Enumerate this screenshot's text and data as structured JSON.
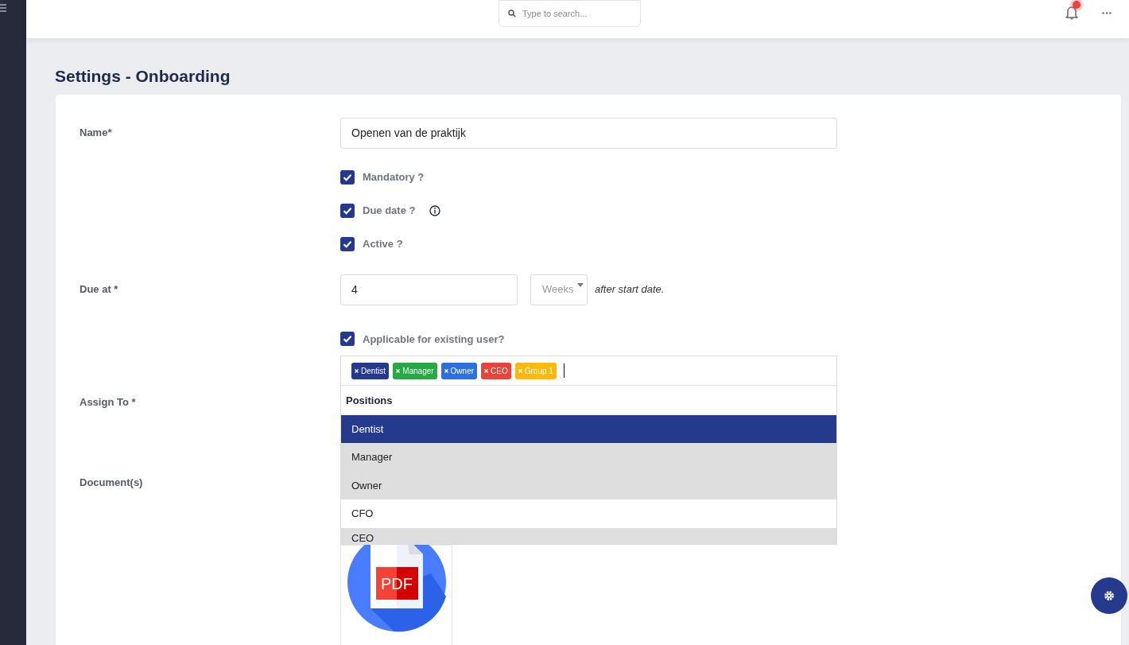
{
  "topbar": {
    "search": {
      "placeholder": "Type to search..."
    },
    "notification_dot": true
  },
  "page_title": "Settings - Onboarding",
  "form": {
    "name": {
      "label": "Name*",
      "value": "Openen van de praktijk"
    },
    "options": [
      {
        "label": "Mandatory ?",
        "checked": true,
        "info": false
      },
      {
        "label": "Due date ?",
        "checked": true,
        "info": true
      },
      {
        "label": "Active ?",
        "checked": true,
        "info": false
      }
    ],
    "due_at": {
      "label": "Due at *",
      "value": "4",
      "unit": "Weeks",
      "suffix": "after start date."
    },
    "existing_user": {
      "label": "Applicable for existing user?",
      "checked": true
    },
    "assign_to": {
      "label": "Assign To *",
      "tags": [
        {
          "label": "Dentist",
          "color": "#253a8c"
        },
        {
          "label": "Manager",
          "color": "#28a745"
        },
        {
          "label": "Owner",
          "color": "#2c6fe0"
        },
        {
          "label": "CEO",
          "color": "#e8423a"
        },
        {
          "label": "Group 1",
          "color": "#fbb90c"
        }
      ],
      "dropdown": {
        "group": "Positions",
        "items": [
          {
            "label": "Dentist",
            "highlighted": true,
            "chosen": true
          },
          {
            "label": "Manager",
            "highlighted": false,
            "chosen": true
          },
          {
            "label": "Owner",
            "highlighted": false,
            "chosen": true
          },
          {
            "label": "CFO",
            "highlighted": false,
            "chosen": false
          },
          {
            "label": "CEO",
            "highlighted": false,
            "chosen": true
          }
        ]
      }
    },
    "documents": {
      "label": "Document(s)",
      "file_icon_label": "PDF"
    }
  }
}
